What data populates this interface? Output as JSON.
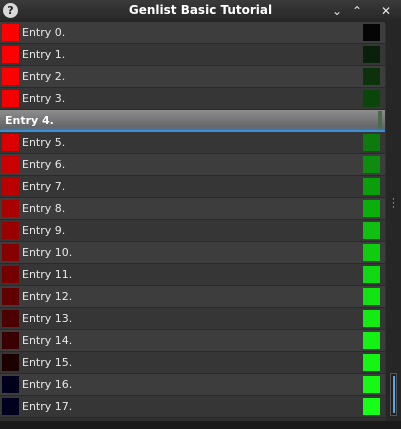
{
  "window": {
    "title": "Genlist Basic Tutorial",
    "help_icon": "?",
    "controls": {
      "minimize": "⌄",
      "maximize": "⌃",
      "close": "✕"
    }
  },
  "list": {
    "items": [
      {
        "label": "Entry 0.",
        "left_color": "#ff0000",
        "right_color": "#050505"
      },
      {
        "label": "Entry 1.",
        "left_color": "#ff0000",
        "right_color": "#0b200b"
      },
      {
        "label": "Entry 2.",
        "left_color": "#ff0000",
        "right_color": "#0b320b"
      },
      {
        "label": "Entry 3.",
        "left_color": "#f50000",
        "right_color": "#0a450a"
      },
      {
        "label": "Entry 4.",
        "selected": true
      },
      {
        "label": "Entry 5.",
        "left_color": "#db0000",
        "right_color": "#0d7a0d"
      },
      {
        "label": "Entry 6.",
        "left_color": "#cb0000",
        "right_color": "#0d8c0d"
      },
      {
        "label": "Entry 7.",
        "left_color": "#bb0000",
        "right_color": "#0a9e0a"
      },
      {
        "label": "Entry 8.",
        "left_color": "#a90000",
        "right_color": "#0ab00a"
      },
      {
        "label": "Entry 9.",
        "left_color": "#990000",
        "right_color": "#10c010"
      },
      {
        "label": "Entry 10.",
        "left_color": "#860000",
        "right_color": "#10cc10"
      },
      {
        "label": "Entry 11.",
        "left_color": "#740000",
        "right_color": "#11d911"
      },
      {
        "label": "Entry 12.",
        "left_color": "#610000",
        "right_color": "#12e412"
      },
      {
        "label": "Entry 13.",
        "left_color": "#4c0000",
        "right_color": "#12ec12"
      },
      {
        "label": "Entry 14.",
        "left_color": "#380000",
        "right_color": "#13f213"
      },
      {
        "label": "Entry 15.",
        "left_color": "#1c0000",
        "right_color": "#14f514"
      },
      {
        "label": "Entry 16.",
        "left_color": "#00001a",
        "right_color": "#15f915"
      },
      {
        "label": "Entry 17.",
        "left_color": "#00001e",
        "right_color": "#16ff16"
      }
    ]
  }
}
